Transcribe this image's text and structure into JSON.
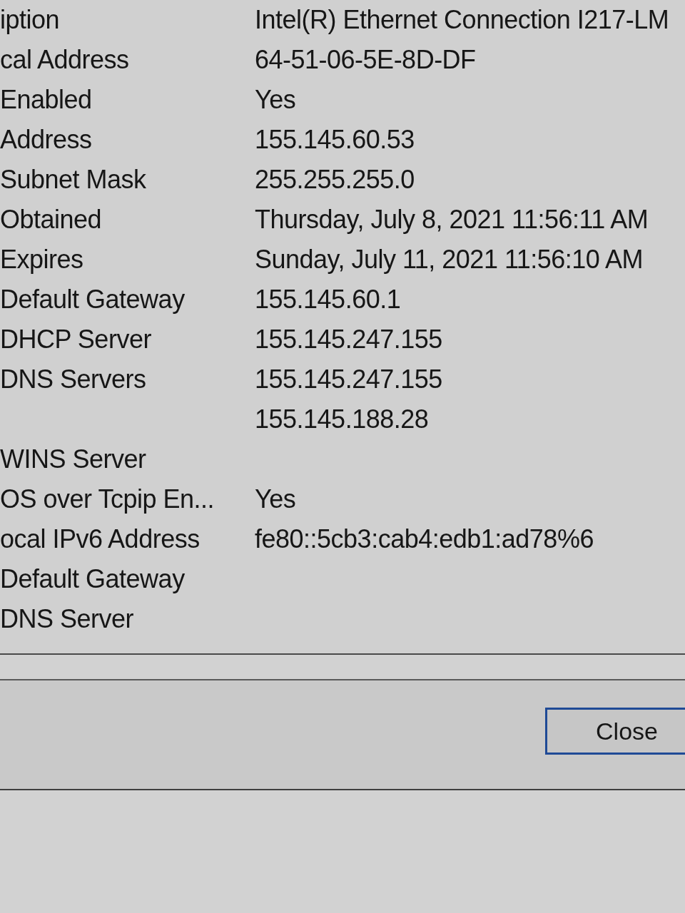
{
  "details": {
    "rows": [
      {
        "property": "iption",
        "values": [
          "Intel(R) Ethernet Connection I217-LM"
        ]
      },
      {
        "property": "cal Address",
        "values": [
          "64-51-06-5E-8D-DF"
        ]
      },
      {
        "property": "Enabled",
        "values": [
          "Yes"
        ]
      },
      {
        "property": "Address",
        "values": [
          "155.145.60.53"
        ]
      },
      {
        "property": "Subnet Mask",
        "values": [
          "255.255.255.0"
        ]
      },
      {
        "property": "Obtained",
        "values": [
          "Thursday, July 8, 2021 11:56:11 AM"
        ]
      },
      {
        "property": "Expires",
        "values": [
          "Sunday, July 11, 2021 11:56:10 AM"
        ]
      },
      {
        "property": "Default Gateway",
        "values": [
          "155.145.60.1"
        ]
      },
      {
        "property": "DHCP Server",
        "values": [
          "155.145.247.155"
        ]
      },
      {
        "property": "DNS Servers",
        "values": [
          "155.145.247.155",
          "155.145.188.28"
        ]
      },
      {
        "property": "WINS Server"
      },
      {
        "property": "OS over Tcpip En...",
        "values": [
          "Yes"
        ]
      },
      {
        "property": "ocal IPv6 Address",
        "values": [
          "fe80::5cb3:cab4:edb1:ad78%6"
        ]
      },
      {
        "property": "Default Gateway"
      },
      {
        "property": "DNS Server"
      }
    ]
  },
  "close_button": {
    "label": "Close"
  }
}
